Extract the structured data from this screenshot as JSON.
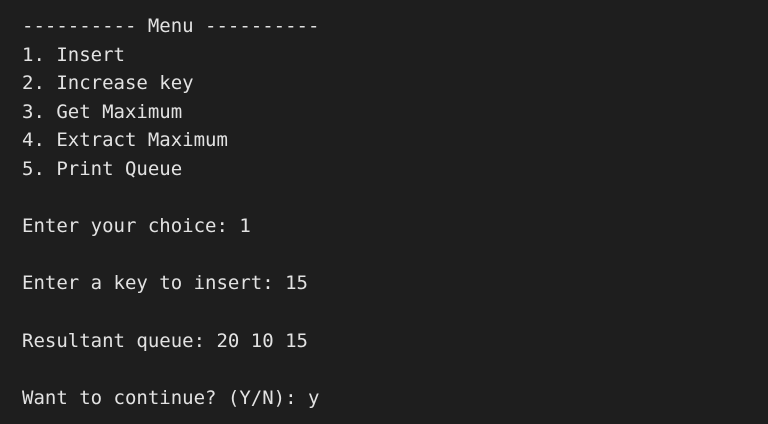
{
  "terminal": {
    "menu_header": "---------- Menu ----------",
    "menu_items": [
      "1. Insert",
      "2. Increase key",
      "3. Get Maximum",
      "4. Extract Maximum",
      "5. Print Queue"
    ],
    "choice_prompt": "Enter your choice: ",
    "choice_value": "1",
    "key_prompt": "Enter a key to insert: ",
    "key_value": "15",
    "result_label": "Resultant queue: ",
    "result_value": "20 10 15",
    "continue_prompt": "Want to continue? (Y/N): ",
    "continue_value": "y"
  }
}
